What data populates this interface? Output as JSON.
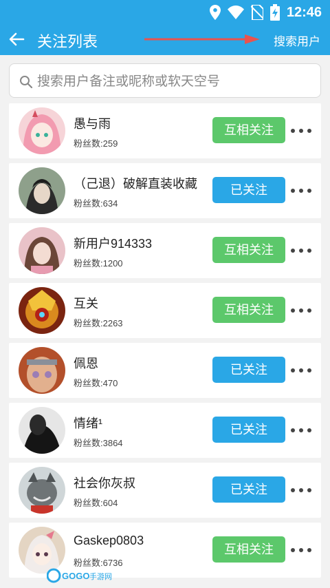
{
  "status": {
    "time": "12:46"
  },
  "header": {
    "title": "关注列表",
    "search_user": "搜索用户"
  },
  "search": {
    "placeholder": "搜索用户备注或昵称或软天空号"
  },
  "colors": {
    "primary": "#2aa7e6",
    "mutual": "#5cc86b"
  },
  "users": [
    {
      "name": "愚与雨",
      "fans": "粉丝数:259",
      "button": "互相关注",
      "state": "mutual"
    },
    {
      "name": "（己退）破解直装收藏",
      "fans": "粉丝数:634",
      "button": "已关注",
      "state": "following"
    },
    {
      "name": "新用户914333",
      "fans": "粉丝数:1200",
      "button": "互相关注",
      "state": "mutual"
    },
    {
      "name": "互关",
      "fans": "粉丝数:2263",
      "button": "互相关注",
      "state": "mutual"
    },
    {
      "name": "佩恩",
      "fans": "粉丝数:470",
      "button": "已关注",
      "state": "following"
    },
    {
      "name": "情绪¹",
      "fans": "粉丝数:3864",
      "button": "已关注",
      "state": "following"
    },
    {
      "name": "社会你灰叔",
      "fans": "粉丝数:604",
      "button": "已关注",
      "state": "following"
    },
    {
      "name": "Gaskep0803",
      "fans": "粉丝数:6736",
      "button": "互相关注",
      "state": "mutual"
    }
  ],
  "watermark": {
    "text": "GOGO手游网"
  }
}
